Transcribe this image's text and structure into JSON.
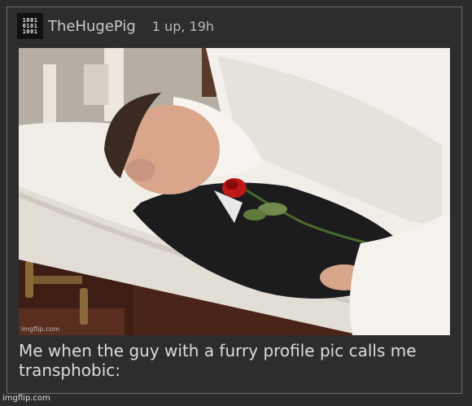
{
  "post": {
    "username": "TheHugePig",
    "meta": "1 up, 19h",
    "avatar": {
      "icon": "binary-digits-icon",
      "rows": [
        "1001",
        "0101",
        "1001"
      ]
    },
    "image": {
      "description_icon": "meme-photo",
      "watermark": "imgflip.com"
    },
    "caption": "Me when the guy with a furry profile pic calls me transphobic:"
  },
  "footer": {
    "watermark": "imgflip.com"
  },
  "colors": {
    "background": "#2b2b2b",
    "border": "#6f6f6f",
    "text": "#dcdcdc"
  }
}
